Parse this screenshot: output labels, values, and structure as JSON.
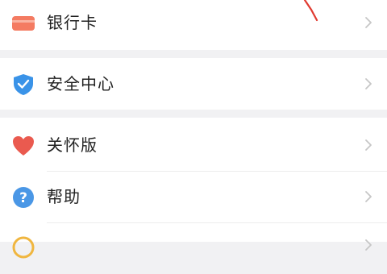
{
  "menu": {
    "items": [
      {
        "id": "bank-card",
        "label": "银行卡",
        "icon": "card-icon",
        "color": "#f47b62"
      },
      {
        "id": "security-center",
        "label": "安全中心",
        "icon": "shield-icon",
        "color": "#3a93e8"
      },
      {
        "id": "care-mode",
        "label": "关怀版",
        "icon": "heart-icon",
        "color": "#ea5a4f"
      },
      {
        "id": "help",
        "label": "帮助",
        "icon": "help-icon",
        "color": "#4a97e6"
      },
      {
        "id": "partial-item",
        "label": "",
        "icon": "circle-icon",
        "color": "#f0b63f"
      }
    ]
  },
  "colors": {
    "background": "#f1f1f3",
    "card": "#ffffff",
    "chevron": "#c6c6c6",
    "annotation": "#e03a30"
  }
}
